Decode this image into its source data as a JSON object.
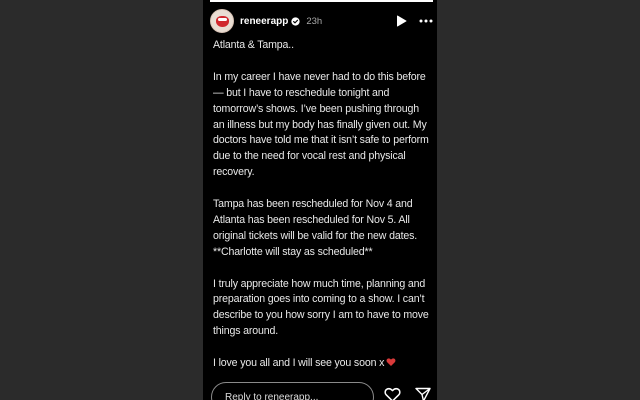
{
  "story": {
    "username": "reneerapp",
    "time": "23h",
    "progress": 1.0
  },
  "message": {
    "paragraphs": [
      "Atlanta & Tampa..",
      "In my career I have never had to do this before— but I have to reschedule tonight and tomorrow’s shows. I’ve been pushing through an illness but my body has finally given out. My doctors have told me that it isn’t safe to perform due to the need for vocal rest and physical recovery.",
      "Tampa has been rescheduled for Nov 4 and Atlanta has been rescheduled for Nov 5. All original tickets will be valid for the new dates. **Charlotte will stay as scheduled**",
      "I truly appreciate how much time, planning and preparation goes into coming to a show. I can’t describe to you how sorry I am to have to move things around."
    ],
    "closing": "I love you all and I will see you soon x"
  },
  "footer": {
    "reply_placeholder": "Reply to reneerapp..."
  },
  "icons": {
    "verified": "verified-badge-icon",
    "play": "play-icon",
    "more": "more-options-icon",
    "heart_emoji": "red-heart-emoji-icon",
    "like": "heart-outline-icon",
    "send": "paper-plane-icon"
  },
  "colors": {
    "story_bg": "#000000",
    "page_bg": "#2b2b2b",
    "verified": "#3897f0",
    "heart": "#d93a3a"
  }
}
